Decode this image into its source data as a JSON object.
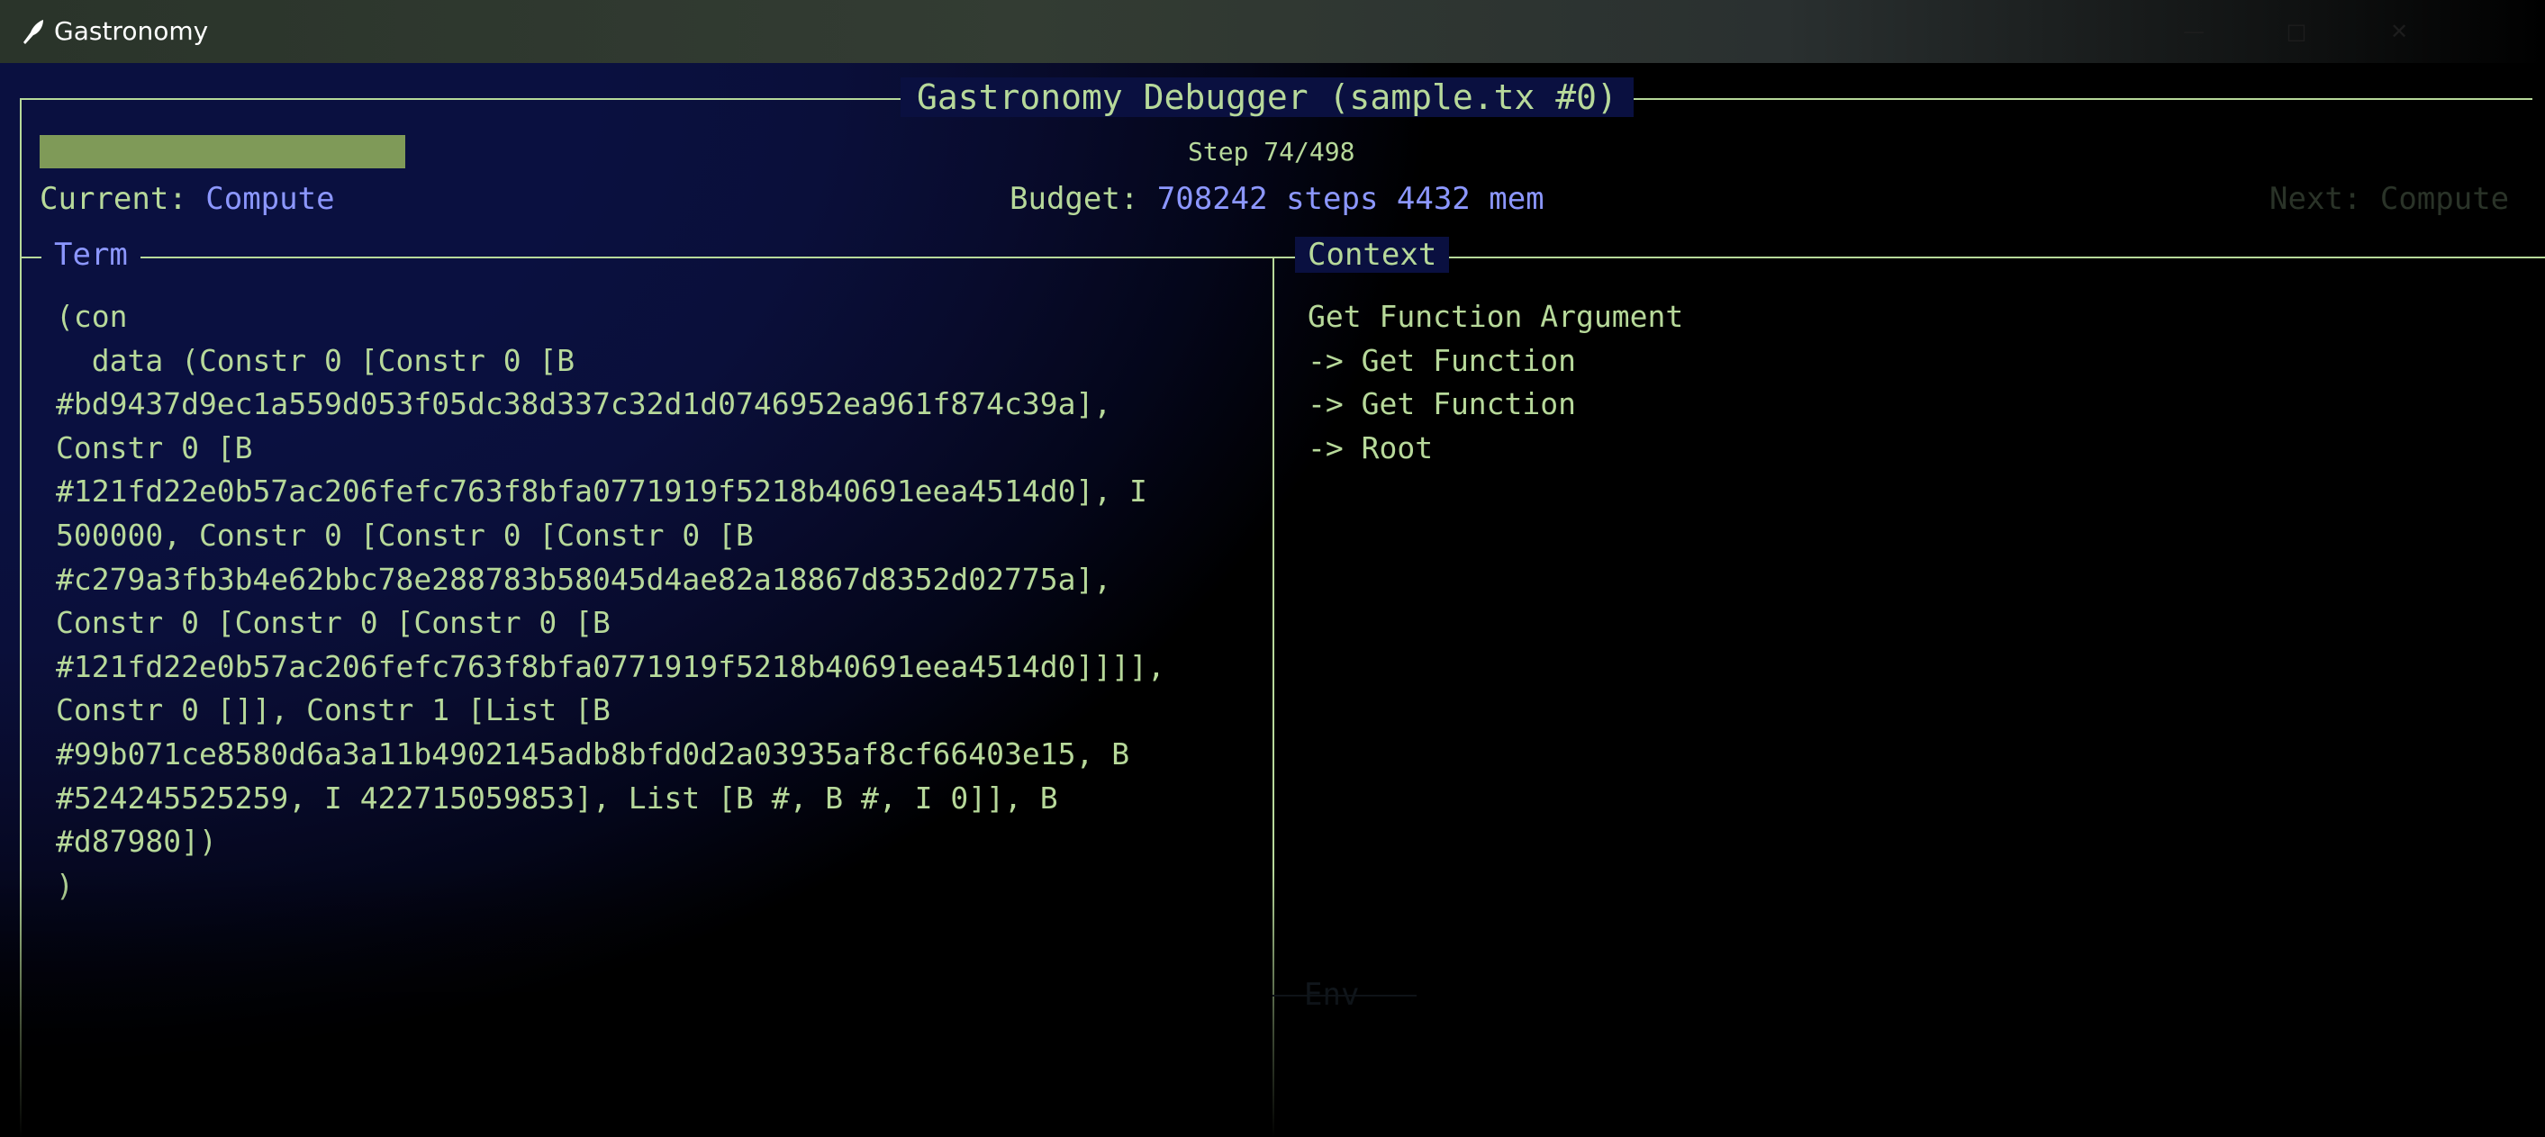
{
  "window": {
    "app_title": "Gastronomy",
    "icon": "gastronomy-spoon-icon",
    "controls": [
      "minimize",
      "maximize",
      "close"
    ]
  },
  "header": {
    "title": "Gastronomy Debugger (sample.tx #0)",
    "step_label": "Step 74/498",
    "progress": 0.1486,
    "current_label": "Current:",
    "current_value": "Compute",
    "budget_label": "Budget:",
    "budget_value": "708242 steps 4432 mem",
    "next_label": "Next:",
    "next_value": "Compute"
  },
  "term_panel": {
    "title": "Term",
    "lines": [
      "(con",
      "  data (Constr 0 [Constr 0 [B",
      "#bd9437d9ec1a559d053f05dc38d337c32d1d0746952ea961f874c39a],",
      "Constr 0 [B",
      "#121fd22e0b57ac206fefc763f8bfa0771919f5218b40691eea4514d0], I",
      "500000, Constr 0 [Constr 0 [Constr 0 [B",
      "#c279a3fb3b4e62bbc78e288783b58045d4ae82a18867d8352d02775a],",
      "Constr 0 [Constr 0 [Constr 0 [B",
      "#121fd22e0b57ac206fefc763f8bfa0771919f5218b40691eea4514d0]]]],",
      "Constr 0 []], Constr 1 [List [B",
      "#99b071ce8580d6a3a11b4902145adb8bfd0d2a03935af8cf66403e15, B",
      "#524245525259, I 422715059853], List [B #, B #, I 0]], B",
      "#d87980])",
      ")"
    ]
  },
  "context_panel": {
    "title": "Context",
    "lines": [
      "Get Function Argument",
      "-> Get Function",
      "-> Get Function",
      "-> Root"
    ]
  },
  "env_panel": {
    "title": "Env"
  },
  "colors": {
    "text": "#b7d99a",
    "accent": "#8c97ff",
    "progress": "#7f9a58",
    "background": "#0a1040"
  }
}
